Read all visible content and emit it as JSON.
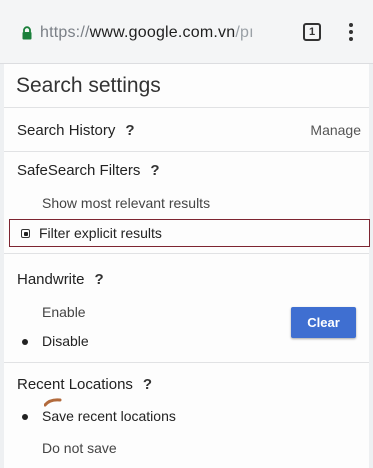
{
  "browser": {
    "url_protocol": "https://",
    "url_host": "www.google.com.vn",
    "url_path": "/pı",
    "tab_count": "1"
  },
  "settings": {
    "title": "Search settings",
    "search_history": {
      "label": "Search History",
      "help": "?",
      "manage_label": "Manage"
    },
    "safesearch": {
      "label": "SafeSearch Filters",
      "help": "?",
      "options": [
        {
          "label": "Show most relevant results",
          "selected": false
        },
        {
          "label": "Filter explicit results",
          "selected": true
        }
      ]
    },
    "handwrite": {
      "label": "Handwrite",
      "help": "?",
      "options": [
        {
          "label": "Enable",
          "selected": false
        },
        {
          "label": "Disable",
          "selected": true
        }
      ]
    },
    "recent_locations": {
      "label": "Recent Locations",
      "help": "?",
      "clear_label": "Clear",
      "options": [
        {
          "label": "Save recent locations",
          "selected": true
        },
        {
          "label": "Do not save",
          "selected": false
        }
      ]
    }
  }
}
